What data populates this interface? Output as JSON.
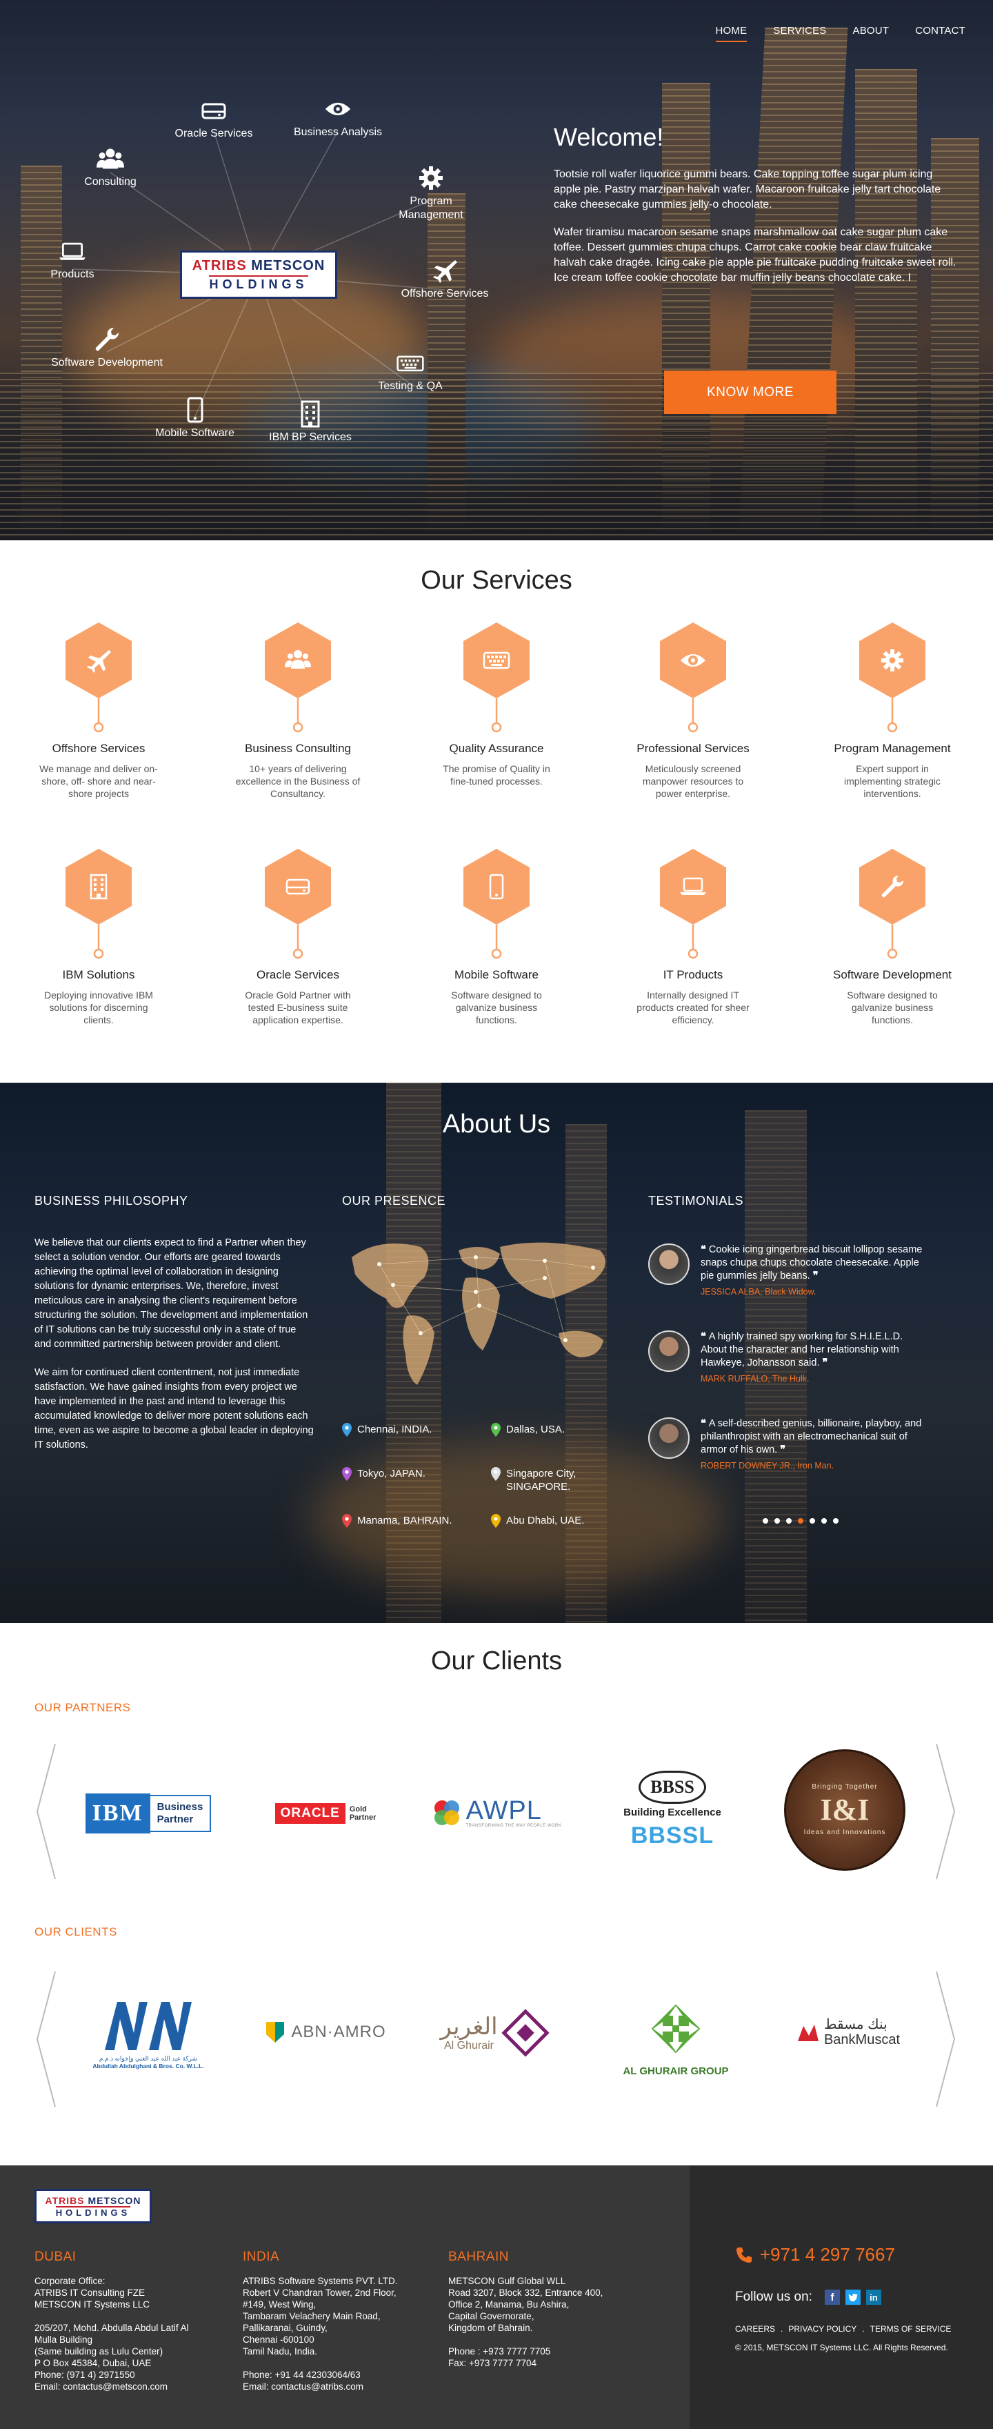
{
  "nav": {
    "items": [
      "HOME",
      "SERVICES",
      "ABOUT",
      "CONTACT"
    ],
    "active": "HOME"
  },
  "hero": {
    "logo": {
      "line1a": "ATRIBS",
      "line1b": "METSCON",
      "line2": "HOLDINGS"
    },
    "nodes": {
      "oracle": "Oracle Services",
      "analysis": "Business Analysis",
      "consulting": "Consulting",
      "program": "Program Management",
      "products": "Products",
      "offshore": "Offshore Services",
      "software": "Software Development",
      "testing": "Testing & QA",
      "mobile": "Mobile Software",
      "ibm": "IBM BP Services"
    },
    "welcome_title": "Welcome!",
    "p1": "Tootsie roll wafer liquorice gummi bears. Cake topping toffee sugar plum icing apple pie. Pastry marzipan halvah wafer. Macaroon fruitcake jelly tart chocolate cake cheesecake gummies jelly-o chocolate.",
    "p2": "Wafer tiramisu macaroon sesame snaps marshmallow oat cake sugar plum cake toffee. Dessert gummies chupa chups. Carrot cake cookie bear claw fruitcake halvah cake dragée. Icing cake pie apple pie fruitcake pudding fruitcake sweet roll. Ice cream toffee cookie chocolate bar muffin jelly beans chocolate cake. I",
    "cta": "KNOW MORE"
  },
  "services": {
    "title": "Our Services",
    "items": [
      {
        "icon": "plane-icon",
        "title": "Offshore Services",
        "desc": "We manage and deliver on-shore, off- shore and near-shore projects"
      },
      {
        "icon": "users-icon",
        "title": "Business Consulting",
        "desc": "10+ years of delivering excellence in the Business of Consultancy."
      },
      {
        "icon": "keyboard-icon",
        "title": "Quality Assurance",
        "desc": "The promise of Quality in fine-tuned processes."
      },
      {
        "icon": "eye-icon",
        "title": "Professional Services",
        "desc": "Meticulously screened manpower resources to power enterprise."
      },
      {
        "icon": "gear-icon",
        "title": "Program Management",
        "desc": "Expert support in implementing strategic interventions."
      },
      {
        "icon": "building-icon",
        "title": "IBM Solutions",
        "desc": "Deploying innovative IBM solutions for discerning clients."
      },
      {
        "icon": "drive-icon",
        "title": "Oracle Services",
        "desc": "Oracle Gold Partner with tested E-business suite application expertise."
      },
      {
        "icon": "mobile-icon",
        "title": "Mobile Software",
        "desc": "Software designed to galvanize business functions."
      },
      {
        "icon": "laptop-icon",
        "title": "IT Products",
        "desc": "Internally designed IT products created for sheer efficiency."
      },
      {
        "icon": "wrench-icon",
        "title": "Software Development",
        "desc": "Software designed to galvanize business functions."
      }
    ]
  },
  "about": {
    "title": "About Us",
    "philosophy_title": "BUSINESS PHILOSOPHY",
    "philosophy_p1": "We believe that our clients expect to find a Partner when they select a solution vendor. Our efforts are geared towards achieving the optimal level of collaboration in designing solutions for dynamic enterprises. We, therefore, invest meticulous care in analysing the client's requirement before structuring the solution. The development and implementation of IT solutions can be truly successful only in a state of true and committed partnership between provider and client.",
    "philosophy_p2": "We aim for continued client contentment, not just immediate satisfaction. We have gained insights from every project we have implemented in the past and intend to leverage this accumulated knowledge to deliver more potent solutions each time, even as we aspire to become a global leader in deploying IT solutions.",
    "presence_title": "OUR PRESENCE",
    "locations": [
      "Chennai, INDIA.",
      "Dallas, USA.",
      "Tokyo, JAPAN.",
      "Singapore City, SINGAPORE.",
      "Manama, BAHRAIN.",
      "Abu Dhabi, UAE."
    ],
    "location_colors": [
      "#3ba3e3",
      "#57c24f",
      "#b25ad6",
      "#dde0e4",
      "#e54848",
      "#f2b705"
    ],
    "testimonials_title": "TESTIMONIALS",
    "testimonials": [
      {
        "quote": "Cookie icing gingerbread biscuit lollipop sesame snaps chupa chups chocolate cheesecake. Apple pie gummies jelly beans.",
        "who": "JESSICA ALBA, Black Widow."
      },
      {
        "quote": "A highly trained spy working for S.H.I.E.L.D. About the character and her relationship with Hawkeye, Johansson said.",
        "who": "MARK RUFFALO, The Hulk."
      },
      {
        "quote": "A self-described genius, billionaire, playboy, and philanthropist with an electromechanical suit of armor of his own.",
        "who": "ROBERT DOWNEY JR., Iron Man."
      }
    ]
  },
  "clients": {
    "title": "Our Clients",
    "partners_title": "OUR PARTNERS",
    "clients_title": "OUR CLIENTS",
    "partners": {
      "ibm": "IBM",
      "ibm_bp1": "Business",
      "ibm_bp2": "Partner",
      "oracle": "ORACLE",
      "oracle_gold": "Gold",
      "oracle_partner": "Partner",
      "awpl": "AWPL",
      "awpl_tag": "TRANSFORMING THE WAY PEOPLE WORK",
      "bbss": "BBSS",
      "bbss_tag": "Building Excellence",
      "bbssl": "BBSSL",
      "ii": "I&I",
      "ii_top": "Bringing Together",
      "ii_ring": "Ideas and Innovations"
    },
    "clients": {
      "nn_ar": "شركة عبد الله عبد الغني وإخوانه ذ.م.م",
      "nn_en": "Abdullah Abdulghani & Bros. Co. W.L.L.",
      "abn": "ABN·AMRO",
      "alg_ar": "الغرير",
      "alg_en": "Al Ghurair",
      "algg": "AL GHURAIR GROUP",
      "bm_ar": "بنك مسقط",
      "bm_en": "BankMuscat"
    }
  },
  "footer": {
    "logo": {
      "line1a": "ATRIBS",
      "line1b": "METSCON",
      "line2": "HOLDINGS"
    },
    "dubai": {
      "title": "DUBAI",
      "p1": [
        "Corporate Office:",
        "ATRIBS IT Consulting FZE",
        "METSCON IT Systems LLC"
      ],
      "p2": [
        "205/207, Mohd. Abdulla Abdul Latif Al",
        "Mulla Building",
        "(Same building as Lulu Center)",
        "P O Box 45384, Dubai, UAE",
        "Phone: (971 4) 2971550",
        "Email: contactus@metscon.com"
      ]
    },
    "india": {
      "title": "INDIA",
      "p1": [
        "ATRIBS Software Systems PVT. LTD.",
        "Robert V Chandran Tower, 2nd Floor,",
        "#149, West Wing,",
        "Tambaram Velachery Main Road,",
        "Pallikaranai, Guindy,",
        "Chennai -600100",
        "Tamil Nadu, India."
      ],
      "p2": [
        "Phone: +91 44 42303064/63",
        "Email: contactus@atribs.com"
      ]
    },
    "bahrain": {
      "title": "BAHRAIN",
      "p1": [
        "METSCON Gulf Global WLL",
        "Road 3207, Block 332, Entrance 400,",
        "Office 2,  Manama, Bu Ashira,",
        "Capital Governorate,",
        "Kingdom of Bahrain."
      ],
      "p2": [
        "Phone : +973 7777 7705",
        "Fax: +973 7777 7704"
      ]
    },
    "phone": "+971 4 297 7667",
    "follow": "Follow us on:",
    "links": [
      "CAREERS",
      "PRIVACY POLICY",
      "TERMS OF SERVICE"
    ],
    "copyright": "© 2015, METSCON IT Systems LLC. All Rights Reserved."
  },
  "colors": {
    "accent": "#f37021",
    "hex": "#f9a36a",
    "footer": "#383838"
  }
}
